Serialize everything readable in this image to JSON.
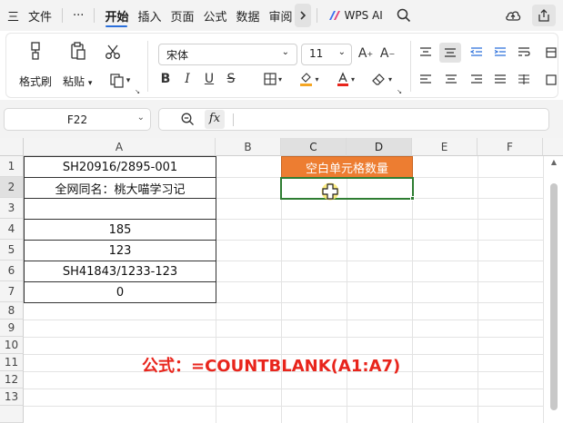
{
  "menubar": {
    "hamburger": "三",
    "file": "文件",
    "more": "···",
    "tabs": [
      "开始",
      "插入",
      "页面",
      "公式",
      "数据",
      "审阅"
    ],
    "active_tab": "开始",
    "wps_ai": "WPS AI"
  },
  "ribbon": {
    "format_painter": "格式刷",
    "paste": "粘贴",
    "font_name": "宋体",
    "font_size": "11"
  },
  "formula_bar": {
    "name_box": "F22",
    "fx": "fx",
    "content": ""
  },
  "grid": {
    "columns": [
      "A",
      "B",
      "C",
      "D",
      "E",
      "F"
    ],
    "rows": [
      "1",
      "2",
      "3",
      "4",
      "5",
      "6",
      "7",
      "8",
      "9",
      "10",
      "11",
      "12",
      "13"
    ],
    "colA": [
      "SH20916/2895-001",
      "全网同名：桃大喵学习记",
      "",
      "185",
      "123",
      "SH41843/1233-123",
      "0"
    ],
    "c1_header": "空白单元格数量",
    "c2_value": ""
  },
  "annotation": "公式：=COUNTBLANK(A1:A7)",
  "colors": {
    "accent_orange": "#ed7d31",
    "active_green": "#2e7d32",
    "annotation_red": "#e8251c"
  }
}
